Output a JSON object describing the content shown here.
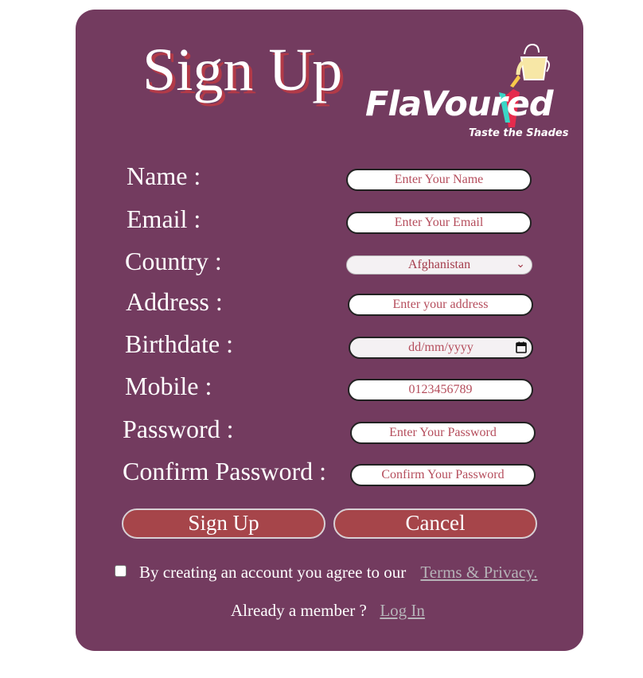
{
  "header": {
    "title": "Sign Up",
    "logo_text": "FlaVoured",
    "logo_tagline": "Taste the Shades"
  },
  "form": {
    "fields": [
      {
        "label": "Name :",
        "placeholder": "Enter Your Name"
      },
      {
        "label": "Email :",
        "placeholder": "Enter Your Email"
      },
      {
        "label": "Country :",
        "value": "Afghanistan"
      },
      {
        "label": "Address :",
        "placeholder": "Enter your address"
      },
      {
        "label": "Birthdate :",
        "placeholder": "dd/mm/yyyy"
      },
      {
        "label": "Mobile :",
        "placeholder": "0123456789"
      },
      {
        "label": "Password :",
        "placeholder": "Enter Your Password"
      },
      {
        "label": "Confirm Password :",
        "placeholder": "Confirm Your Password"
      }
    ]
  },
  "buttons": {
    "signup": "Sign Up",
    "cancel": "Cancel"
  },
  "agreement": {
    "text": "By creating an account you agree to our",
    "link": "Terms & Privacy."
  },
  "login": {
    "text": "Already a member ?",
    "link": "Log In"
  },
  "colors": {
    "card": "#733b5f",
    "button": "#a6454a",
    "placeholder": "#b54d5c",
    "title_shadow": "#b23a48"
  },
  "icons": {
    "dropdown": "chevron-down-icon",
    "calendar": "calendar-icon",
    "logo_drink": "drink-glass-icon"
  }
}
